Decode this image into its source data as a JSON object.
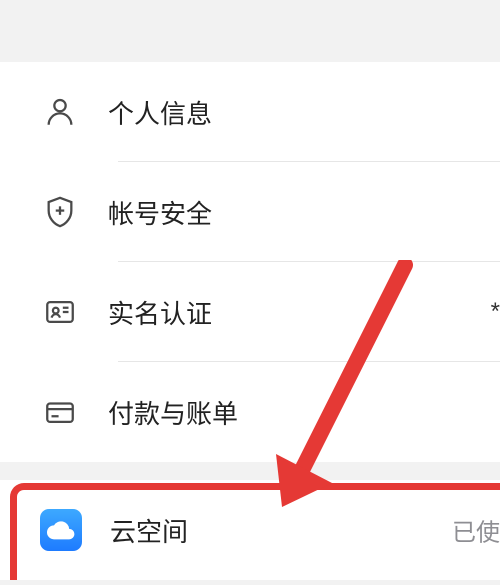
{
  "settings": {
    "items": [
      {
        "label": "个人信息"
      },
      {
        "label": "帐号安全"
      },
      {
        "label": "实名认证",
        "right": "*"
      },
      {
        "label": "付款与账单"
      }
    ]
  },
  "cloud": {
    "label": "云空间",
    "status": "已使"
  }
}
